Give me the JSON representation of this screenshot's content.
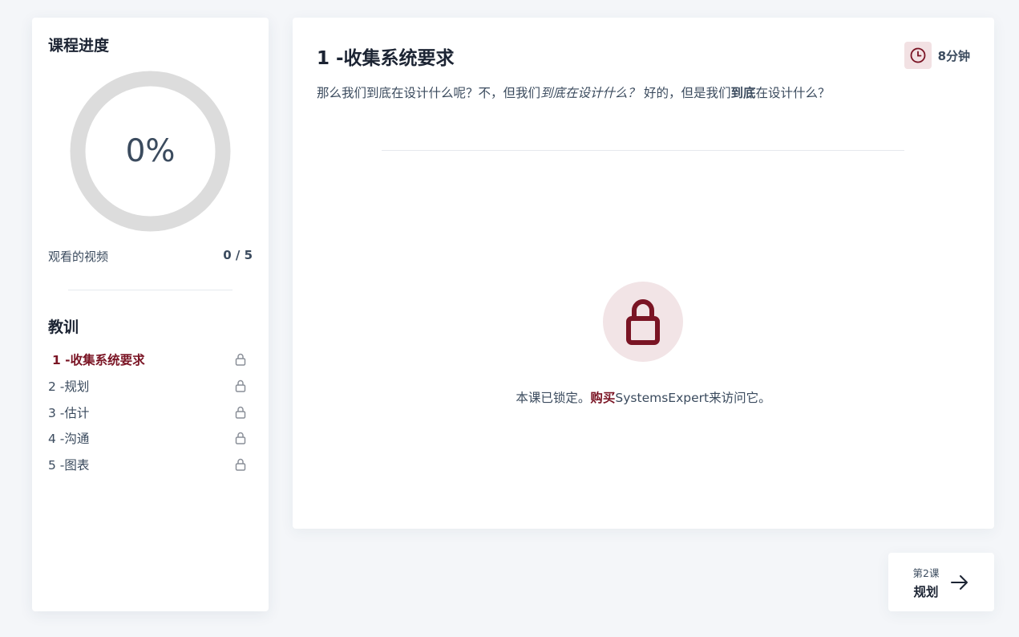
{
  "sidebar": {
    "title": "课程进度",
    "progress": {
      "percent": 0,
      "label": "0%"
    },
    "videos_label": "观看的视频",
    "videos_count": "0 / 5",
    "lessons_title": "教训",
    "lessons": [
      {
        "label": "1 -收集系统要求",
        "active": true,
        "icon": "lock-icon"
      },
      {
        "label": "2 -规划",
        "active": false,
        "icon": "lock-icon"
      },
      {
        "label": "3 -估计",
        "active": false,
        "icon": "lock-icon"
      },
      {
        "label": "4 -沟通",
        "active": false,
        "icon": "lock-icon"
      },
      {
        "label": "5 -图表",
        "active": false,
        "icon": "lock-icon"
      }
    ]
  },
  "main": {
    "title": "1 -收集系统要求",
    "duration": "8分钟",
    "duration_icon": "clock-icon",
    "description": {
      "part1": "那么我们到底在设计什么呢？不，但我们",
      "em": "到底在设计什么？",
      "part2": "好的，但是我们",
      "strong": "到底",
      "part3": "在设计什么？"
    },
    "locked_icon": "lock-icon",
    "locked": {
      "prefix": "本课已锁定。",
      "link": "购买",
      "suffix": "SystemsExpert来访问它。"
    }
  },
  "next": {
    "sub": "第2课",
    "title": "规划",
    "icon": "arrow-right-icon"
  },
  "colors": {
    "accent": "#7a1424",
    "accent_light": "#f2e4e6",
    "ring_track": "#dcdcdc",
    "background": "#f4f6f9",
    "text": "#3b4b5e"
  }
}
